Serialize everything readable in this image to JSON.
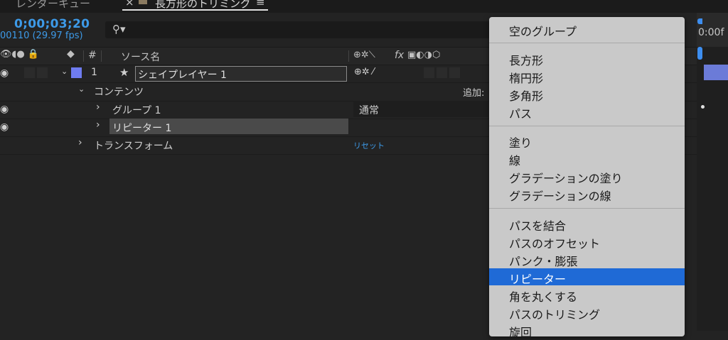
{
  "tabs": [
    {
      "label": "レンダーキュー"
    },
    {
      "label": "長方形のトリミング",
      "active": true,
      "close": "×",
      "menu": "≡"
    }
  ],
  "header": {
    "timecode": "0;00;03;20",
    "frame_info": "00110 (29.97 fps)",
    "search_icon": "search-icon"
  },
  "columns": {
    "source_name": "ソース名",
    "number": "#",
    "switch_fx": "fx"
  },
  "layers": [
    {
      "number": "1",
      "name": "シェイプレイヤー 1",
      "label_color": "#6f7cf0"
    }
  ],
  "tree": {
    "contents": "コンテンツ",
    "add": "追加:",
    "group": "グループ 1",
    "group_mode": "通常",
    "repeater": "リピーター 1",
    "transform": "トランスフォーム",
    "reset": "リセット"
  },
  "timeline": {
    "ruler_label": "0:00f"
  },
  "menu": {
    "items": [
      {
        "label": "空のグループ",
        "group": 1
      },
      {
        "label": "長方形",
        "group": 2
      },
      {
        "label": "楕円形",
        "group": 2
      },
      {
        "label": "多角形",
        "group": 2
      },
      {
        "label": "パス",
        "group": 2
      },
      {
        "label": "塗り",
        "group": 3
      },
      {
        "label": "線",
        "group": 3
      },
      {
        "label": "グラデーションの塗り",
        "group": 3
      },
      {
        "label": "グラデーションの線",
        "group": 3
      },
      {
        "label": "パスを結合",
        "group": 4
      },
      {
        "label": "パスのオフセット",
        "group": 4
      },
      {
        "label": "パンク・膨張",
        "group": 4
      },
      {
        "label": "リピーター",
        "group": 4,
        "highlighted": true
      },
      {
        "label": "角を丸くする",
        "group": 4
      },
      {
        "label": "パスのトリミング",
        "group": 4
      },
      {
        "label": "旋回",
        "group": 4
      }
    ]
  },
  "colors": {
    "accent": "#3d9ae8",
    "menu_highlight": "#1f6ad6",
    "layer_bar": "#6b7bd8"
  }
}
